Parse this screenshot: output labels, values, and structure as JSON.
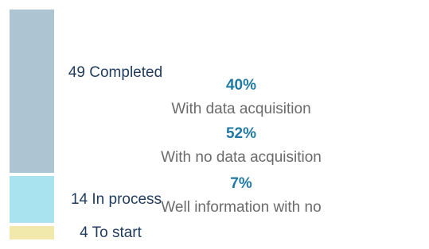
{
  "chart_data": {
    "type": "bar",
    "orientation": "vertical-stacked",
    "segments": [
      {
        "label": "49 Completed",
        "value": 49,
        "color": "#adc4d3"
      },
      {
        "label": "14 In process",
        "value": 14,
        "color": "#a8e3ef"
      },
      {
        "label": "4 To start",
        "value": 4,
        "color": "#f1e9ac"
      }
    ],
    "stats": [
      {
        "pct": "40%",
        "text": "With data acquisition"
      },
      {
        "pct": "52%",
        "text": "With no data acquisition"
      },
      {
        "pct": "7%",
        "text": "Well information with no"
      }
    ]
  }
}
